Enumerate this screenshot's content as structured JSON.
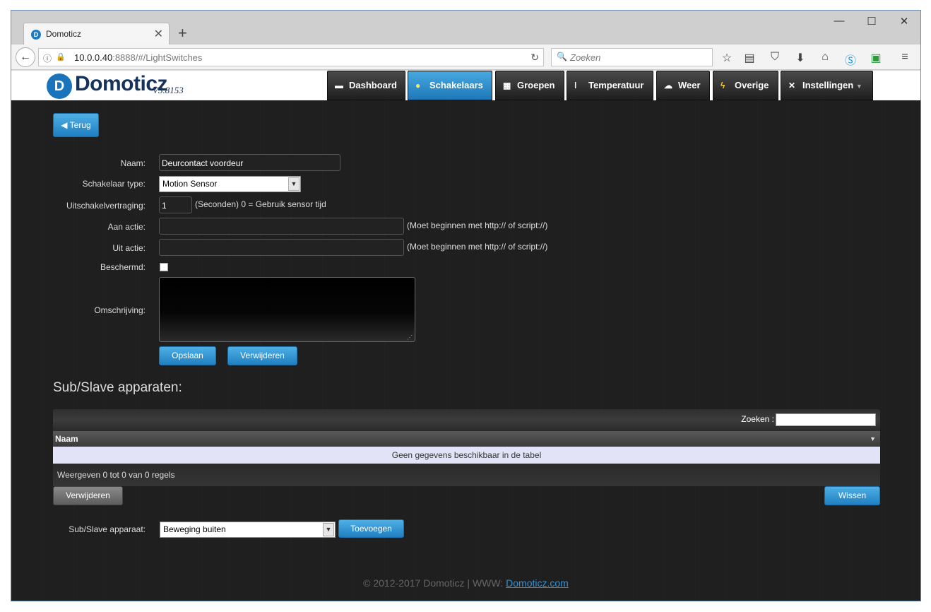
{
  "browser": {
    "tab_title": "Domoticz",
    "tab_favicon": "domoticz-logo-icon",
    "url_host": "10.0.0.40",
    "url_rest": ":8888/#/LightSwitches",
    "search_placeholder": "Zoeken"
  },
  "app": {
    "logo_text": "Domoticz",
    "logo_letter": "D",
    "version": "V3.8153",
    "nav": [
      {
        "label": "Dashboard",
        "icon": "monitor-icon"
      },
      {
        "label": "Schakelaars",
        "icon": "lightbulb-icon",
        "active": true
      },
      {
        "label": "Groepen",
        "icon": "clapperboard-icon"
      },
      {
        "label": "Temperatuur",
        "icon": "thermometer-icon"
      },
      {
        "label": "Weer",
        "icon": "cloud-rain-icon"
      },
      {
        "label": "Overige",
        "icon": "lightning-icon"
      },
      {
        "label": "Instellingen",
        "icon": "tools-icon"
      }
    ]
  },
  "form": {
    "back_label": "Terug",
    "name_label": "Naam:",
    "name_value": "Deurcontact voordeur",
    "type_label": "Schakelaar type:",
    "type_value": "Motion Sensor",
    "delay_label": "Uitschakelvertraging:",
    "delay_value": "1",
    "delay_note": "(Seconden) 0 = Gebruik sensor tijd",
    "on_action_label": "Aan actie:",
    "on_action_value": "",
    "off_action_label": "Uit actie:",
    "off_action_value": "",
    "action_note": "(Moet beginnen met http:// of script://)",
    "protected_label": "Beschermd:",
    "description_label": "Omschrijving:",
    "save_label": "Opslaan",
    "delete_label": "Verwijderen"
  },
  "subslave": {
    "title": "Sub/Slave apparaten:",
    "search_label": "Zoeken :",
    "column_name": "Naam",
    "empty_text": "Geen gegevens beschikbaar in de tabel",
    "info_text": "Weergeven 0 tot 0 van 0 regels",
    "delete_label": "Verwijderen",
    "clear_label": "Wissen",
    "device_label": "Sub/Slave apparaat:",
    "device_value": "Beweging buiten",
    "add_label": "Toevoegen"
  },
  "footer": {
    "text": "© 2012-2017 Domoticz | WWW: ",
    "link": "Domoticz.com"
  }
}
